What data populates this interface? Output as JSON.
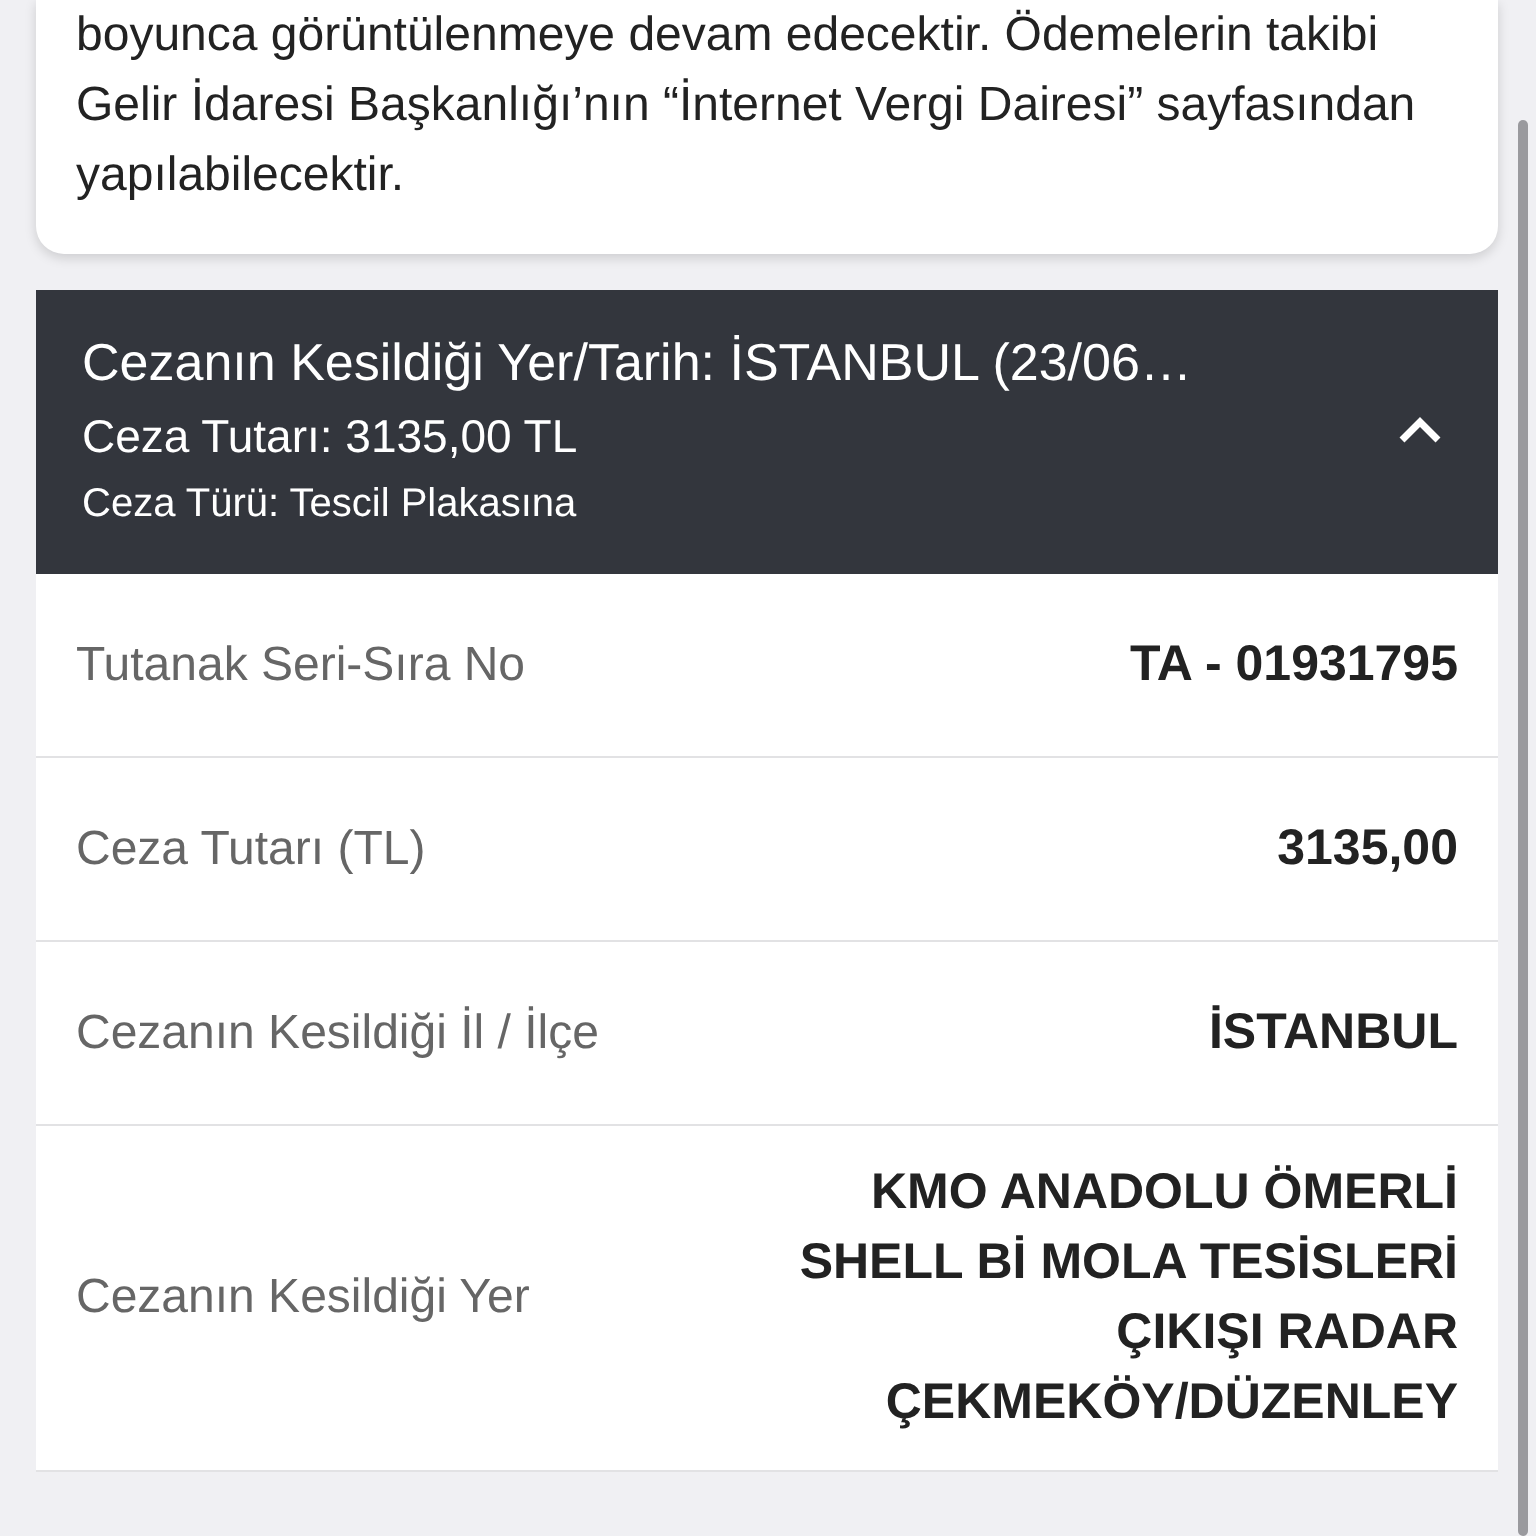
{
  "notice": {
    "text": "boyunca görüntülenmeye devam edecektir. Ödemelerin takibi Gelir İdaresi Başkanlığı’nın “İnternet Vergi Dairesi” sayfasından yapılabilecektir."
  },
  "penalty": {
    "expanded": true,
    "title": "Cezanın Kesildiği Yer/Tarih: İSTANBUL (23/06…",
    "amount": "Ceza Tutarı: 3135,00 TL",
    "type": "Ceza Türü: Tescil Plakasına",
    "rows": [
      {
        "label": "Tutanak Seri-Sıra No",
        "value": "TA - 01931795"
      },
      {
        "label": "Ceza Tutarı (TL)",
        "value": "3135,00"
      },
      {
        "label": "Cezanın Kesildiği İl / İlçe",
        "value": "İSTANBUL"
      },
      {
        "label": "Cezanın Kesildiği Yer",
        "value": "KMO ANADOLU ÖMERLİ SHELL Bİ MOLA TESİSLERİ ÇIKIŞI RADAR ÇEKMEKÖY/DÜZENLEY"
      }
    ]
  }
}
